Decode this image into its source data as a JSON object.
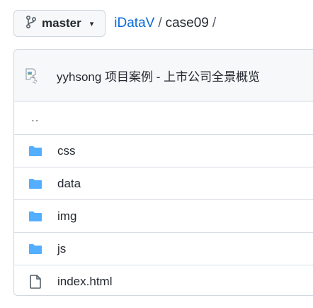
{
  "branch": {
    "icon": "git-branch-icon",
    "name": "master",
    "caret": "▾"
  },
  "breadcrumb": {
    "repo": "iDataV",
    "sep1": "/",
    "dir": "case09",
    "sep2": "/"
  },
  "commit": {
    "avatar_icon": "broken-avatar-image-icon",
    "message": "yyhsong 项目案例 - 上市公司全景概览"
  },
  "parent_dir": {
    "label": ".."
  },
  "files": [
    {
      "name": "css",
      "type": "directory",
      "icon": "folder-icon"
    },
    {
      "name": "data",
      "type": "directory",
      "icon": "folder-icon"
    },
    {
      "name": "img",
      "type": "directory",
      "icon": "folder-icon"
    },
    {
      "name": "js",
      "type": "directory",
      "icon": "folder-icon"
    },
    {
      "name": "index.html",
      "type": "file",
      "icon": "file-icon"
    }
  ],
  "colors": {
    "folder": "#54aeff",
    "link": "#0969da",
    "border": "#d0d7de"
  }
}
